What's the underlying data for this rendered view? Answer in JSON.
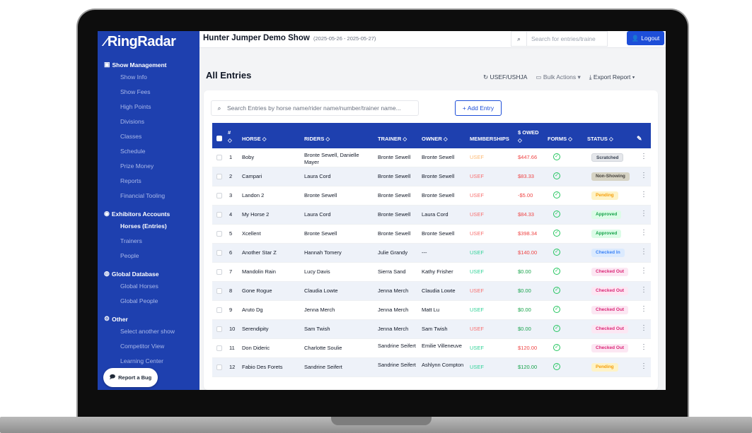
{
  "app": {
    "logo": "RingRadar",
    "logout_label": "Logout"
  },
  "sidebar": {
    "sections": [
      {
        "title": "Show Management",
        "items": [
          "Show Info",
          "Show Fees",
          "High Points",
          "Divisions",
          "Classes",
          "Schedule",
          "Prize Money",
          "Reports",
          "Financial Tooling"
        ]
      },
      {
        "title": "Exhibitors Accounts",
        "items": [
          "Horses (Entries)",
          "Trainers",
          "People"
        ]
      },
      {
        "title": "Global Database",
        "items": [
          "Global Horses",
          "Global People"
        ]
      },
      {
        "title": "Other",
        "items": [
          "Select another show",
          "Competitor View",
          "Learning Center"
        ]
      }
    ],
    "active_item": "Horses (Entries)",
    "report_bug_label": "Report a Bug"
  },
  "topbar": {
    "show_title": "Hunter Jumper Demo Show",
    "show_dates": "(2025-05-26 - 2025-05-27)",
    "search_placeholder": "Search for entries/traine"
  },
  "page": {
    "title": "All Entries",
    "actions": {
      "usef": "USEF/USHJA",
      "bulk": "Bulk Actions",
      "export": "Export Report"
    },
    "entries_search_placeholder": "Search Entries by horse name/rider name/number/trainer name...",
    "add_entry_label": "+ Add Entry"
  },
  "table": {
    "columns": {
      "num": "#",
      "num_sort": "◇",
      "horse": "HORSE ◇",
      "riders": "RIDERS ◇",
      "trainer": "TRAINER ◇",
      "owner": "OWNER ◇",
      "memberships": "MEMBERSHIPS",
      "owed": "$ OWED",
      "owed_sort": "◇",
      "forms": "FORMS ◇",
      "status": "STATUS ◇"
    },
    "rows": [
      {
        "num": "1",
        "horse": "Boby",
        "riders": "Bronte Sewell, Danielle Mayer",
        "trainer": "Bronte Sewell",
        "owner": "Bronte Sewell",
        "membership": "USEF",
        "membership_color": "#fdba74",
        "owed": "$447.66",
        "owed_color": "#ef4444",
        "status": "Scratched",
        "status_class": "b-scratched"
      },
      {
        "num": "2",
        "horse": "Campari",
        "riders": "Laura Cord",
        "trainer": "Bronte Sewell",
        "owner": "Bronte Sewell",
        "membership": "USEF",
        "membership_color": "#f87171",
        "owed": "$83.33",
        "owed_color": "#ef4444",
        "status": "Non-Showing",
        "status_class": "b-nonshow"
      },
      {
        "num": "3",
        "horse": "Landon 2",
        "riders": "Bronte Sewell",
        "trainer": "Bronte Sewell",
        "owner": "Bronte Sewell",
        "membership": "USEF",
        "membership_color": "#f87171",
        "owed": "-$5.00",
        "owed_color": "#ef4444",
        "status": "Pending",
        "status_class": "b-pending"
      },
      {
        "num": "4",
        "horse": "My Horse 2",
        "riders": "Laura Cord",
        "trainer": "Bronte Sewell",
        "owner": "Laura Cord",
        "membership": "USEF",
        "membership_color": "#f87171",
        "owed": "$84.33",
        "owed_color": "#ef4444",
        "status": "Approved",
        "status_class": "b-approved"
      },
      {
        "num": "5",
        "horse": "Xcellent",
        "riders": "Bronte Sewell",
        "trainer": "Bronte Sewell",
        "owner": "Bronte Sewell",
        "membership": "USEF",
        "membership_color": "#f87171",
        "owed": "$398.34",
        "owed_color": "#ef4444",
        "status": "Approved",
        "status_class": "b-approved"
      },
      {
        "num": "6",
        "horse": "Another Star Z",
        "riders": "Hannah Tomery",
        "trainer": "Julie Grandy",
        "owner": "---",
        "membership": "USEF",
        "membership_color": "#34d399",
        "owed": "$140.00",
        "owed_color": "#ef4444",
        "status": "Checked In",
        "status_class": "b-checkedin"
      },
      {
        "num": "7",
        "horse": "Mandolin Rain",
        "riders": "Lucy Davis",
        "trainer": "Sierra Sand",
        "owner": "Kathy Frisher",
        "membership": "USEF",
        "membership_color": "#34d399",
        "owed": "$0.00",
        "owed_color": "#16a34a",
        "status": "Checked Out",
        "status_class": "b-checkedout"
      },
      {
        "num": "8",
        "horse": "Gone Rogue",
        "riders": "Claudia Lowte",
        "trainer": "Jenna Merch",
        "owner": "Claudia Lowte",
        "membership": "USEF",
        "membership_color": "#f87171",
        "owed": "$0.00",
        "owed_color": "#16a34a",
        "status": "Checked Out",
        "status_class": "b-checkedout"
      },
      {
        "num": "9",
        "horse": "Aruto Dg",
        "riders": "Jenna Merch",
        "trainer": "Jenna Merch",
        "owner": "Matt Lu",
        "membership": "USEF",
        "membership_color": "#34d399",
        "owed": "$0.00",
        "owed_color": "#16a34a",
        "status": "Checked Out",
        "status_class": "b-checkedout"
      },
      {
        "num": "10",
        "horse": "Serendipity",
        "riders": "Sam Twish",
        "trainer": "Jenna Merch",
        "owner": "Sam Twish",
        "membership": "USEF",
        "membership_color": "#f87171",
        "owed": "$0.00",
        "owed_color": "#16a34a",
        "status": "Checked Out",
        "status_class": "b-checkedout"
      },
      {
        "num": "11",
        "horse": "Don Dideric",
        "riders": "Charlotte Soulie",
        "trainer": "Sandrine Seifert",
        "owner": "Emilie Villeneuve",
        "membership": "USEF",
        "membership_color": "#34d399",
        "owed": "$120.00",
        "owed_color": "#ef4444",
        "status": "Checked Out",
        "status_class": "b-checkedout"
      },
      {
        "num": "12",
        "horse": "Fabio Des Forets",
        "riders": "Sandrine Seifert",
        "trainer": "Sandrine Seifert",
        "owner": "Ashlynn Compton",
        "membership": "USEF",
        "membership_color": "#34d399",
        "owed": "$120.00",
        "owed_color": "#16a34a",
        "status": "Pending",
        "status_class": "b-pending"
      }
    ]
  }
}
